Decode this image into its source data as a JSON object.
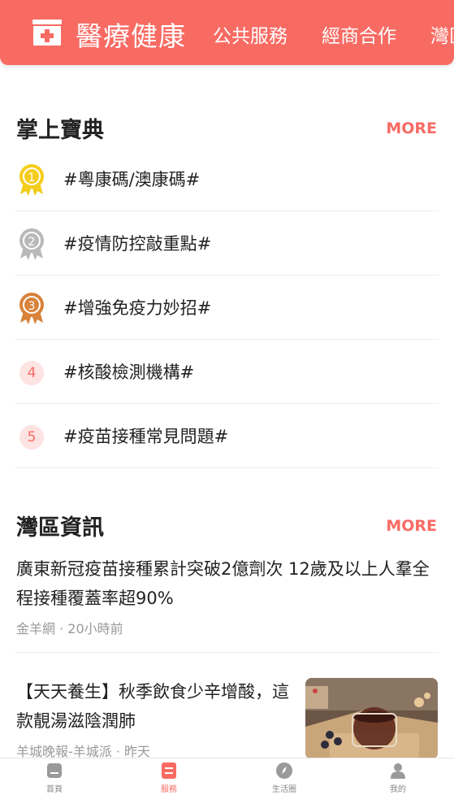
{
  "header": {
    "title": "醫療健康",
    "tabs": [
      "公共服務",
      "經商合作",
      "灣區"
    ]
  },
  "handbook": {
    "title": "掌上寶典",
    "more": "MORE",
    "items": [
      {
        "rank": "1",
        "label": "#粵康碼/澳康碼#"
      },
      {
        "rank": "2",
        "label": "#疫情防控敲重點#"
      },
      {
        "rank": "3",
        "label": "#增強免疫力妙招#"
      },
      {
        "rank": "4",
        "label": "#核酸檢測機構#"
      },
      {
        "rank": "5",
        "label": "#疫苗接種常見問題#"
      }
    ]
  },
  "bay_news": {
    "title": "灣區資訊",
    "more": "MORE",
    "articles": [
      {
        "headline": "廣東新冠疫苗接種累計突破2億劑次 12歲及以上人羣全程接種覆蓋率超90%",
        "meta": "金羊網 · 20小時前"
      },
      {
        "headline": "【天天養生】秋季飲食少辛增酸，這款靚湯滋陰潤肺",
        "meta": "羊城晚報-羊城派 · 昨天"
      }
    ]
  },
  "bottom_nav": {
    "items": [
      {
        "label": "首頁",
        "icon": "home-icon"
      },
      {
        "label": "服務",
        "icon": "service-icon"
      },
      {
        "label": "生活圈",
        "icon": "compass-icon"
      },
      {
        "label": "我的",
        "icon": "user-icon"
      }
    ],
    "active": "服務"
  },
  "colors": {
    "accent": "#f86b63",
    "gold": "#f4cc1b",
    "silver": "#b9b9b9",
    "bronze": "#d9823a"
  }
}
